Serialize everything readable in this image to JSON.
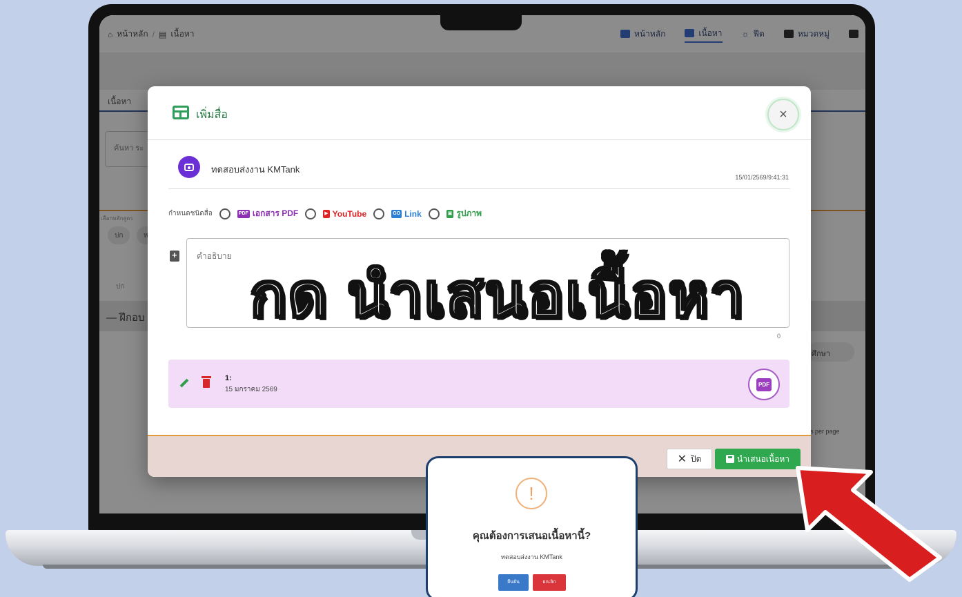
{
  "nav": {
    "breadcrumb_home": "หน้าหลัก",
    "breadcrumb_sep": "/",
    "breadcrumb_current": "เนื้อหา",
    "items": [
      {
        "label": "หน้าหลัก",
        "icon": "dashboard-icon",
        "color": "#3f6fd4"
      },
      {
        "label": "เนื้อหา",
        "icon": "document-icon",
        "color": "#3f6fd4"
      },
      {
        "label": "ฟีด",
        "icon": "rss-icon",
        "color": "#555555"
      },
      {
        "label": "หมวดหมู่",
        "icon": "folder-icon",
        "color": "#333333"
      }
    ]
  },
  "app": {
    "section_title": "เนื้อหา",
    "search_placeholder": "ค้นหา ระ",
    "filter_label": "เลือกหลักสูตร",
    "chips": [
      "ปก",
      "ห"
    ],
    "col_head": "ปก",
    "group_title": "— ฝึกอบ",
    "chip_right": "ศึกษา",
    "rows_per_page": "s per page"
  },
  "modal": {
    "title": "เพิ่มสื่อ",
    "user_name": "ทดสอบส่งงาน KMTank",
    "timestamp": "15/01/2569/9:41:31",
    "type_label": "กำหนดชนิดสื่อ",
    "options": [
      {
        "badge": "PDF",
        "label": "เอกสาร PDF",
        "color": "#8e2fb5"
      },
      {
        "badge": "▶",
        "label": "YouTube",
        "color": "#e02424"
      },
      {
        "badge": "GO",
        "label": "Link",
        "color": "#2b7fd6"
      },
      {
        "badge": "▣",
        "label": "รูปภาพ",
        "color": "#2e9e4a"
      }
    ],
    "desc_placeholder": "คำอธิบาย",
    "char_count": "0",
    "file_number": "1:",
    "file_date": "15 มกราคม 2569",
    "file_badge": "PDF",
    "close_label": "ปิด",
    "submit_label": "นำเสนอเนื้อหา"
  },
  "caption": "กด นำเสนอเนื้อหา",
  "confirm": {
    "question": "คุณต้องการเสนอเนื้อหานี้?",
    "subtitle": "ทดสอบส่งงาน KMTank",
    "ok_label": "ยืนยัน",
    "cancel_label": "ยกเลิก"
  }
}
